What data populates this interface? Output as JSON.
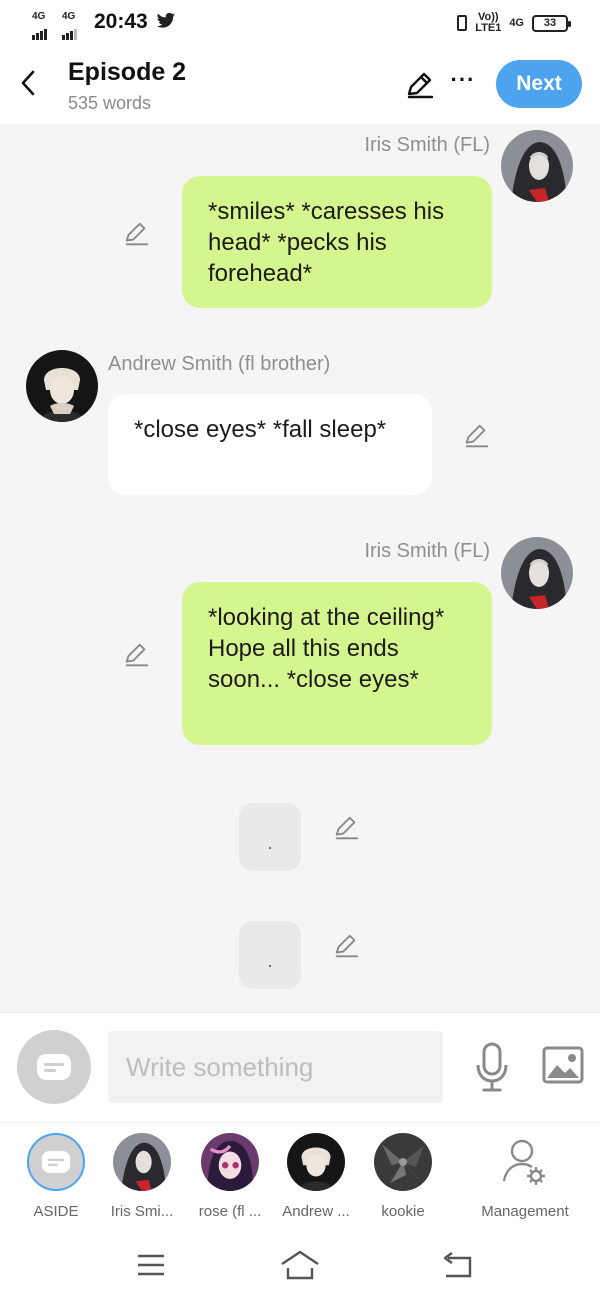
{
  "status_bar": {
    "network_1": "4G",
    "network_2": "4G",
    "time": "20:43",
    "volte": "Vo))",
    "lte": "LTE1",
    "network_3": "4G",
    "battery": "33"
  },
  "header": {
    "title": "Episode 2",
    "word_count": "535 words",
    "next_label": "Next"
  },
  "messages": [
    {
      "speaker": "Iris Smith (FL)",
      "side": "right",
      "text": "*smiles* *caresses his head* *pecks his forehead*"
    },
    {
      "speaker": "Andrew Smith (fl brother)",
      "side": "left",
      "text": "*close eyes* *fall sleep*"
    },
    {
      "speaker": "Iris Smith (FL)",
      "side": "right",
      "text": "*looking at the ceiling* Hope all this ends soon... *close eyes*"
    },
    {
      "speaker": "",
      "side": "aside",
      "text": "."
    },
    {
      "speaker": "",
      "side": "aside",
      "text": "."
    }
  ],
  "composer": {
    "placeholder": "Write something"
  },
  "characters": [
    {
      "label": "ASIDE",
      "icon": "aside-icon"
    },
    {
      "label": "Iris Smi...",
      "icon": "avatar"
    },
    {
      "label": "rose (fl ...",
      "icon": "avatar"
    },
    {
      "label": "Andrew ...",
      "icon": "avatar"
    },
    {
      "label": "kookie",
      "icon": "avatar"
    },
    {
      "label": "Management",
      "icon": "management-icon"
    }
  ],
  "colors": {
    "accent": "#4da3ee",
    "right_bubble": "#d5f58e",
    "left_bubble": "#ffffff",
    "chat_background": "#f5f5f5"
  }
}
